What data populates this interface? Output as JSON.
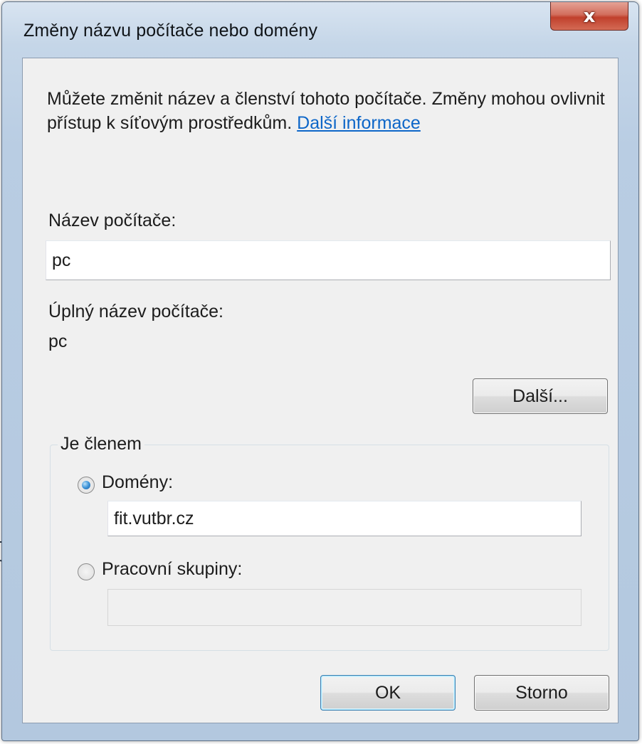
{
  "window": {
    "title": "Změny názvu počítače nebo domény",
    "close_glyph": "x"
  },
  "description": {
    "text": "Můžete změnit název a členství tohoto počítače. Změny mohou ovlivnit přístup k síťovým prostředkům. ",
    "link": "Další informace"
  },
  "computer_name": {
    "label": "Název počítače:",
    "value": "pc"
  },
  "full_name": {
    "label": "Úplný název počítače:",
    "value": "pc"
  },
  "more_button": {
    "label": "Další..."
  },
  "membership": {
    "legend": "Je členem",
    "domain": {
      "label": "Domény:",
      "checked": true,
      "value": "fit.vutbr.cz"
    },
    "workgroup": {
      "label": "Pracovní skupiny:",
      "checked": false,
      "value": ""
    }
  },
  "ok_button": {
    "label": "OK"
  },
  "cancel_button": {
    "label": "Storno"
  },
  "colors": {
    "link": "#0d66c8",
    "close_button": "#c1402c",
    "frame": "#b9cde3"
  }
}
